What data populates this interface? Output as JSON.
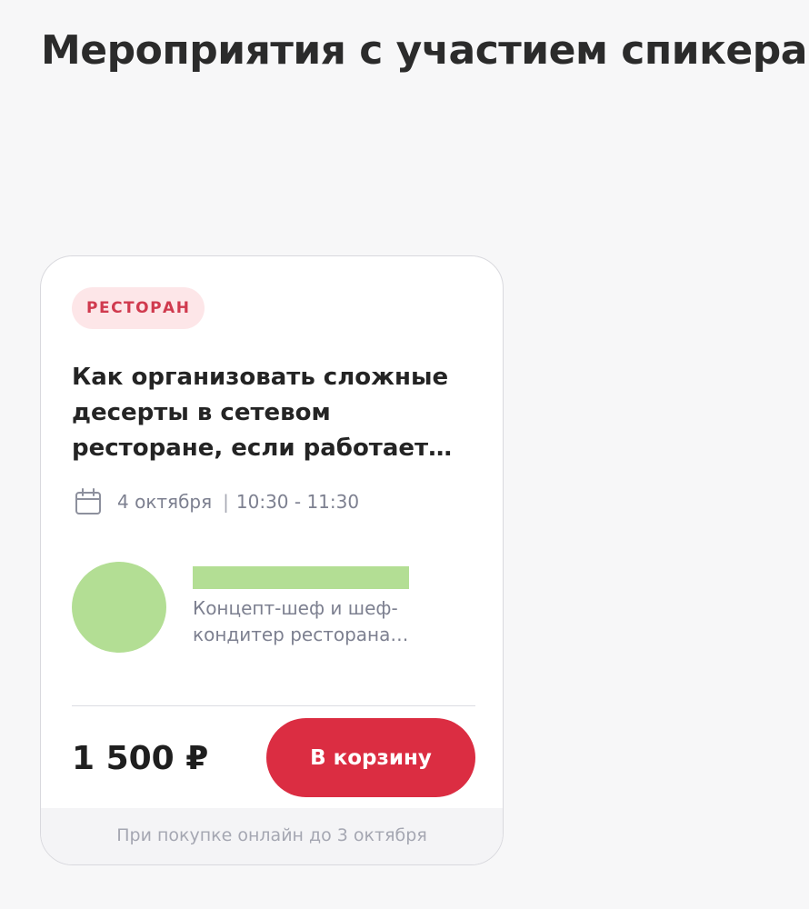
{
  "page": {
    "title": "Мероприятия с участием спикера"
  },
  "event": {
    "category": "РЕСТОРАН",
    "title": "Как организовать сложные десерты в сетевом ресторане, если работает…",
    "date": "4 октября",
    "separator": "|",
    "time": "10:30 - 11:30",
    "speaker": {
      "role": "Концепт-шеф и шеф-кондитер ресторана…"
    },
    "price": "1 500 ₽",
    "cart_button_label": "В корзину",
    "footer_note": "При покупке онлайн до 3 октября"
  },
  "icons": {
    "date": "calendar-icon"
  },
  "colors": {
    "accent": "#db2d42",
    "badge_bg": "#fde6e8",
    "badge_text": "#d03a4e",
    "muted_text": "#7d8090",
    "redaction": "#b3de94"
  }
}
